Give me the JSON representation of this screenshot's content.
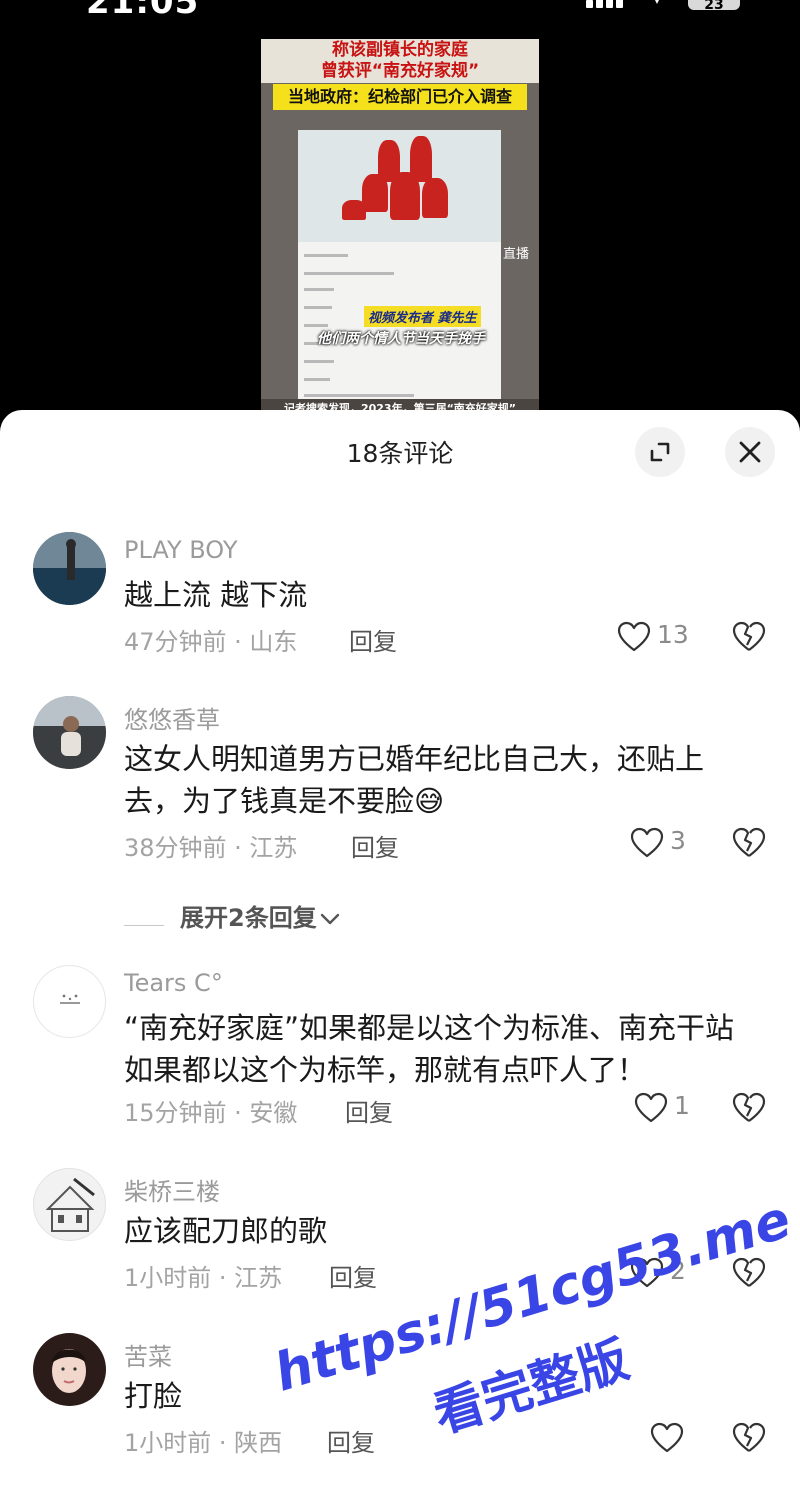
{
  "status_bar": {
    "time": "21:05",
    "battery": "23"
  },
  "video": {
    "headline_line1": "称该副镇长的家庭",
    "headline_line2": "曾获评“南充好家规”",
    "subheadline": "当地政府：纪检部门已介入调查",
    "caption_publisher": "视频发布者 龚先生",
    "caption_quote": "他们两个情人节当天手挽手",
    "live_label": "直播",
    "bottom_caption": "记者搜索发现，2023年，第三届“南充好家规”"
  },
  "sheet": {
    "title": "18条评论"
  },
  "comments": [
    {
      "user": "PLAY BOY",
      "text": "越上流 越下流",
      "time_location": "47分钟前 · 山东",
      "reply_label": "回复",
      "likes": "13"
    },
    {
      "user": "悠悠香草",
      "text": "这女人明知道男方已婚年纪比自己大，还贴上去，为了钱真是不要脸😅",
      "time_location": "38分钟前 · 江苏",
      "reply_label": "回复",
      "likes": "3"
    },
    {
      "user": "Tears   C°",
      "text": "“南充好家庭”如果都是以这个为标准、南充干站如果都以这个为标竿，那就有点吓人了！",
      "time_location": "15分钟前 · 安徽",
      "reply_label": "回复",
      "likes": "1"
    },
    {
      "user": "柴桥三楼",
      "text": "应该配刀郎的歌",
      "time_location": "1小时前 · 江苏",
      "reply_label": "回复",
      "likes": "2"
    },
    {
      "user": "苦菜",
      "text": "打脸",
      "time_location": "1小时前 · 陕西",
      "reply_label": "回复",
      "likes": ""
    }
  ],
  "expand_replies": "展开2条回复",
  "watermark": {
    "line1": "https://51cg53.me",
    "line2": "看完整版"
  },
  "colors": {
    "watermark": "#3a45e6",
    "sheet_bg": "#ffffff",
    "screen_bg": "#000000"
  }
}
